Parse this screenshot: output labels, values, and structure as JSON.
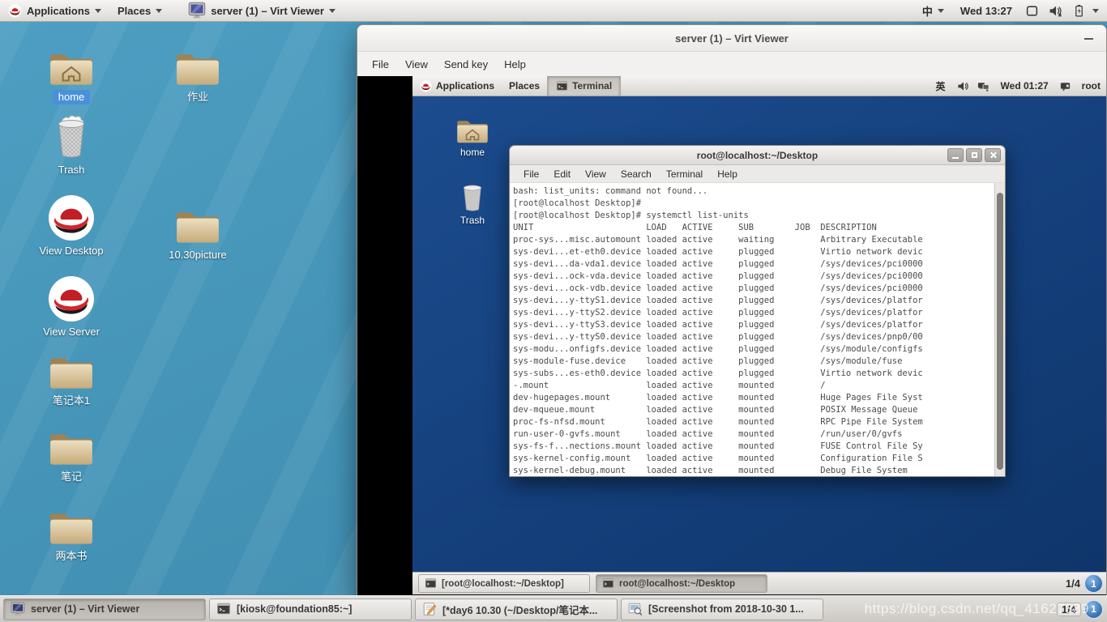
{
  "host_panel": {
    "apps_menu": "Applications",
    "places_menu": "Places",
    "window_menu": "server (1) – Virt Viewer",
    "input_method": "中",
    "clock": "Wed 13:27"
  },
  "host_desktop": {
    "icons": [
      {
        "label": "home"
      },
      {
        "label": "作业"
      },
      {
        "label": "Trash"
      },
      {
        "label": "View Desktop"
      },
      {
        "label": "10.30picture"
      },
      {
        "label": "View Server"
      },
      {
        "label": "笔记本1"
      },
      {
        "label": "笔记"
      },
      {
        "label": "两本书"
      }
    ]
  },
  "virt_viewer": {
    "title": "server (1) – Virt Viewer",
    "menus": [
      "File",
      "View",
      "Send key",
      "Help"
    ]
  },
  "guest_panel": {
    "apps_menu": "Applications",
    "places_menu": "Places",
    "window_button": "Terminal",
    "input_method": "英",
    "clock": "Wed 01:27",
    "user": "root"
  },
  "guest_desktop": {
    "icons": [
      {
        "label": "home"
      },
      {
        "label": "Trash"
      }
    ]
  },
  "terminal": {
    "title": "root@localhost:~/Desktop",
    "menus": [
      "File",
      "Edit",
      "View",
      "Search",
      "Terminal",
      "Help"
    ],
    "lines": [
      "bash: list_units: command not found...",
      "[root@localhost Desktop]# ",
      "[root@localhost Desktop]# systemctl list-units",
      "UNIT                      LOAD   ACTIVE     SUB        JOB  DESCRIPTION",
      "proc-sys...misc.automount loaded active     waiting         Arbitrary Executable",
      "sys-devi...et-eth0.device loaded active     plugged         Virtio network devic",
      "sys-devi...da-vda1.device loaded active     plugged         /sys/devices/pci0000",
      "sys-devi...ock-vda.device loaded active     plugged         /sys/devices/pci0000",
      "sys-devi...ock-vdb.device loaded active     plugged         /sys/devices/pci0000",
      "sys-devi...y-ttyS1.device loaded active     plugged         /sys/devices/platfor",
      "sys-devi...y-ttyS2.device loaded active     plugged         /sys/devices/platfor",
      "sys-devi...y-ttyS3.device loaded active     plugged         /sys/devices/platfor",
      "sys-devi...y-ttyS0.device loaded active     plugged         /sys/devices/pnp0/00",
      "sys-modu...onfigfs.device loaded active     plugged         /sys/module/configfs",
      "sys-module-fuse.device    loaded active     plugged         /sys/module/fuse",
      "sys-subs...es-eth0.device loaded active     plugged         Virtio network devic",
      "-.mount                   loaded active     mounted         /",
      "dev-hugepages.mount       loaded active     mounted         Huge Pages File Syst",
      "dev-mqueue.mount          loaded active     mounted         POSIX Message Queue",
      "proc-fs-nfsd.mount        loaded active     mounted         RPC Pipe File System",
      "run-user-0-gvfs.mount     loaded active     mounted         /run/user/0/gvfs",
      "sys-fs-f...nections.mount loaded active     mounted         FUSE Control File Sy",
      "sys-kernel-config.mount   loaded active     mounted         Configuration File S",
      "sys-kernel-debug.mount    loaded active     mounted         Debug File System"
    ]
  },
  "guest_taskbar": {
    "windows": [
      "[root@localhost:~/Desktop]",
      "root@localhost:~/Desktop"
    ],
    "workspace": "1/4",
    "workspace_badge": "1"
  },
  "host_taskbar": {
    "windows": [
      "server (1) – Virt Viewer",
      "[kiosk@foundation85:~]",
      "[*day6 10.30 (~/Desktop/笔记本...",
      "[Screenshot from 2018-10-30 1..."
    ],
    "workspace": "1/4",
    "workspace_badge": "1"
  },
  "watermark": "https://blog.csdn.net/qq_41627389",
  "colors": {
    "host_desktop": "#4392b5",
    "guest_desktop": "#16417d",
    "selection_blue": "#4a90d9"
  }
}
